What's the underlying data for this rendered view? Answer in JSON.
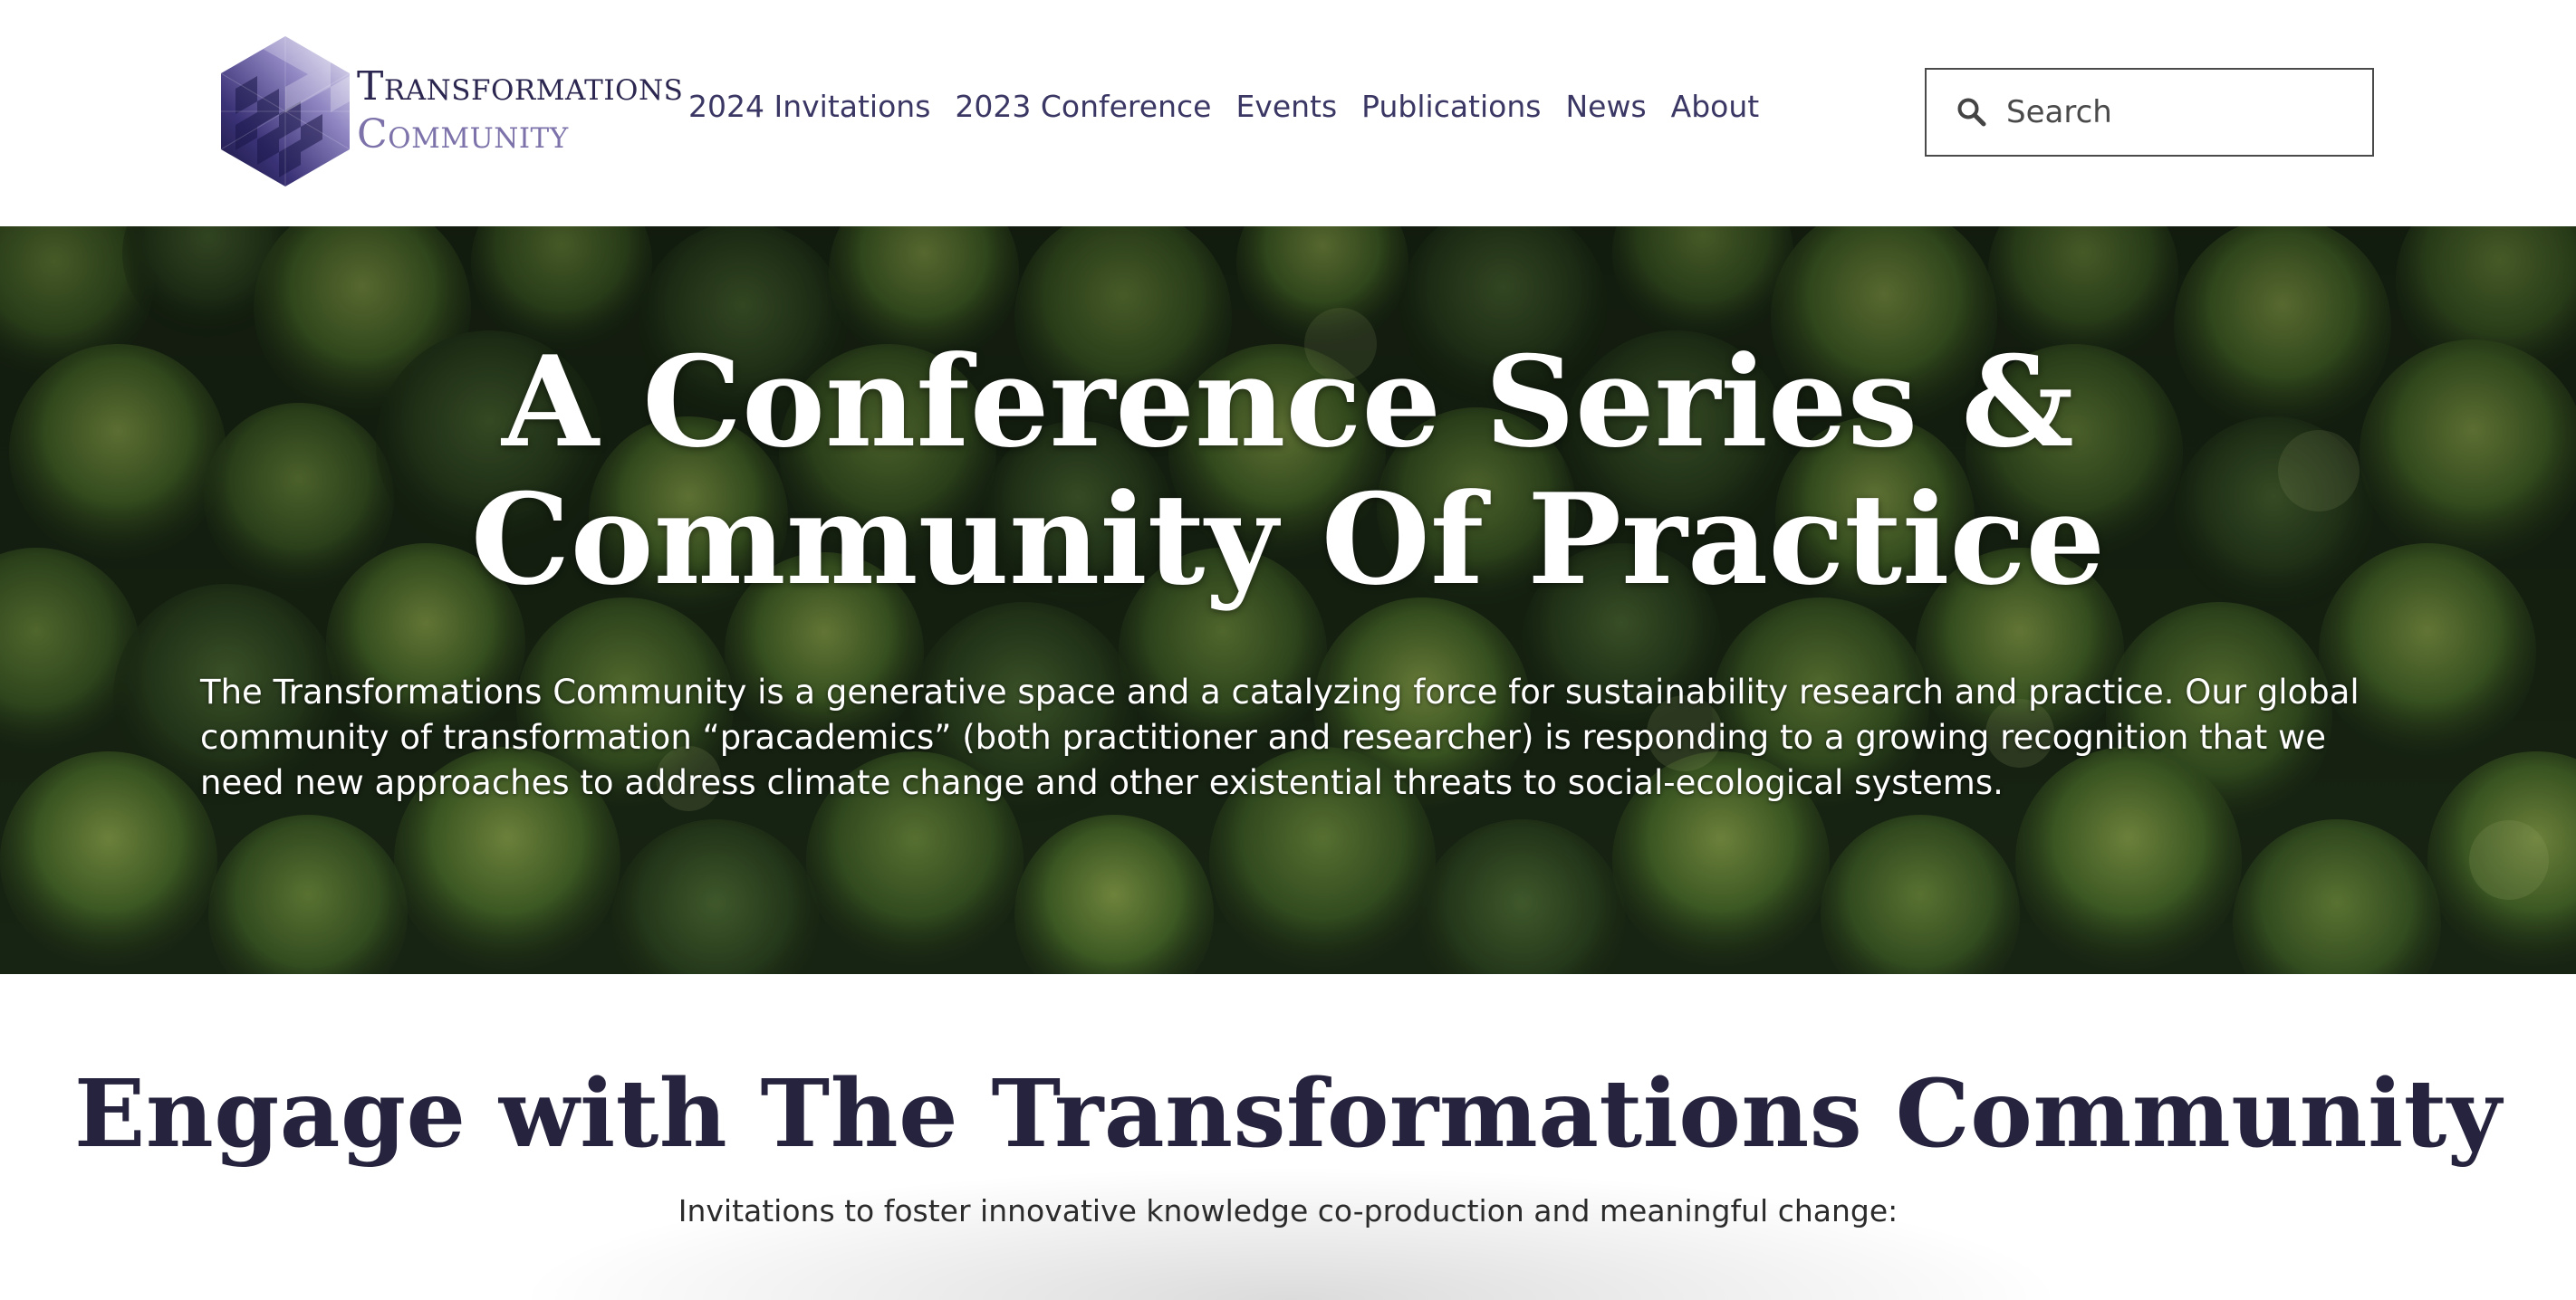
{
  "header": {
    "logo": {
      "line1": "Transformations",
      "line2": "Community",
      "colors": {
        "dark": "#2b2750",
        "light": "#7d73aa"
      }
    },
    "nav": [
      {
        "label": "2024 Invitations"
      },
      {
        "label": "2023 Conference"
      },
      {
        "label": "Events"
      },
      {
        "label": "Publications"
      },
      {
        "label": "News"
      },
      {
        "label": "About"
      }
    ],
    "search": {
      "placeholder": "Search",
      "value": "",
      "icon": "search-icon"
    }
  },
  "hero": {
    "title_line1": "A Conference Series &",
    "title_line2": "Community Of Practice",
    "intro": "The Transformations Community is a generative space and a catalyzing force for sustainability research and practice. Our global community of transformation “pracademics” (both practitioner and researcher) is responding to a growing recognition that we need new approaches to address climate change and other existential threats to social-ecological systems.",
    "background": "aerial-forest-image"
  },
  "engage": {
    "heading": "Engage with The Transformations Community",
    "subheading": "Invitations to foster innovative knowledge co-production and meaningful change:"
  },
  "colors": {
    "nav_text": "#3b3764",
    "heading_text": "#25233d",
    "hero_text": "#ffffff"
  }
}
